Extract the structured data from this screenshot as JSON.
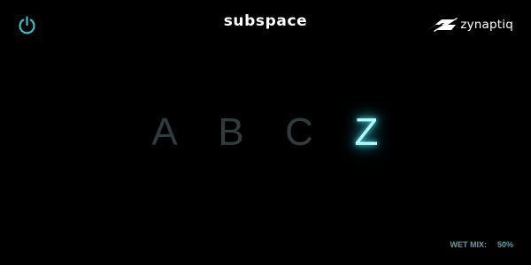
{
  "header": {
    "power": {
      "icon": "power-icon",
      "state": "on",
      "color": "#33c3d3"
    },
    "product_name": "subspace",
    "brand": {
      "icon": "zynaptiq-logo",
      "name": "zynaptiq"
    }
  },
  "presets": {
    "items": [
      {
        "label": "A",
        "active": false
      },
      {
        "label": "B",
        "active": false
      },
      {
        "label": "C",
        "active": false
      },
      {
        "label": "Z",
        "active": true
      }
    ],
    "inactive_color": "#2f3b3c",
    "active_color": "#b7f6fb",
    "glow_color": "#46d8e6"
  },
  "footer": {
    "wet_mix_label": "WET MIX:",
    "wet_mix_value": "50%"
  }
}
